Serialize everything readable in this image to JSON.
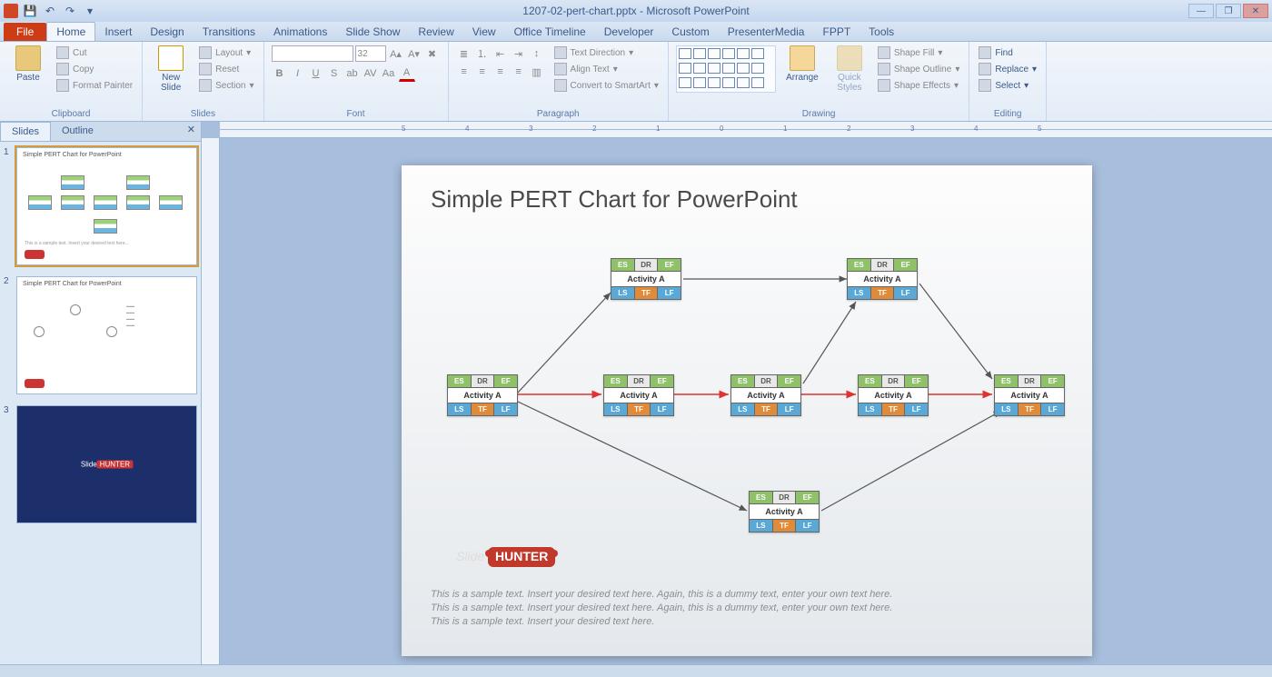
{
  "app": {
    "filename": "1207-02-pert-chart.pptx",
    "appname": "Microsoft PowerPoint"
  },
  "tabs": {
    "file": "File",
    "list": [
      "Home",
      "Insert",
      "Design",
      "Transitions",
      "Animations",
      "Slide Show",
      "Review",
      "View",
      "Office Timeline",
      "Developer",
      "Custom",
      "PresenterMedia",
      "FPPT",
      "Tools"
    ],
    "active": "Home"
  },
  "ribbon": {
    "clipboard": {
      "label": "Clipboard",
      "paste": "Paste",
      "cut": "Cut",
      "copy": "Copy",
      "format_painter": "Format Painter"
    },
    "slides": {
      "label": "Slides",
      "new_slide": "New\nSlide",
      "layout": "Layout",
      "reset": "Reset",
      "section": "Section"
    },
    "font": {
      "label": "Font",
      "size": "32"
    },
    "paragraph": {
      "label": "Paragraph",
      "text_direction": "Text Direction",
      "align_text": "Align Text",
      "convert": "Convert to SmartArt"
    },
    "drawing": {
      "label": "Drawing",
      "arrange": "Arrange",
      "quick": "Quick\nStyles",
      "shape_fill": "Shape Fill",
      "shape_outline": "Shape Outline",
      "shape_effects": "Shape Effects"
    },
    "editing": {
      "label": "Editing",
      "find": "Find",
      "replace": "Replace",
      "select": "Select"
    }
  },
  "side": {
    "slides": "Slides",
    "outline": "Outline"
  },
  "thumbs": {
    "t1_title": "Simple PERT Chart for PowerPoint",
    "t2_title": "Simple PERT Chart for PowerPoint"
  },
  "ruler_ticks": [
    "5",
    "4",
    "3",
    "2",
    "1",
    "0",
    "1",
    "2",
    "3",
    "4",
    "5"
  ],
  "slide": {
    "title": "Simple PERT Chart for PowerPoint",
    "node_labels": {
      "es": "ES",
      "dr": "DR",
      "ef": "EF",
      "ls": "LS",
      "tf": "TF",
      "lf": "LF",
      "activity": "Activity A"
    },
    "logo_pre": "Slide",
    "logo_badge": "HUNTER",
    "sample1": "This is a sample text. Insert your desired text here. Again, this is a dummy text, enter your own text here.",
    "sample2": "This is a sample text. Insert your desired text here. Again, this is a dummy text, enter your own text here.",
    "sample3": "This is a sample text. Insert your desired text here."
  }
}
